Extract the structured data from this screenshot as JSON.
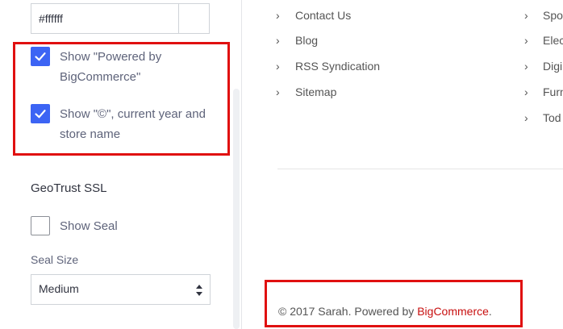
{
  "settings": {
    "color_value": "#ffffff",
    "powered_by_label_line1": "Show \"Powered by",
    "powered_by_label_line2": "BigCommerce\"",
    "copyright_label_line1": "Show \"©\", current year and",
    "copyright_label_line2": "store name",
    "geotrust_heading": "GeoTrust SSL",
    "show_seal_label": "Show Seal",
    "seal_size_label": "Seal Size",
    "seal_size_value": "Medium",
    "powered_by_checked": true,
    "copyright_checked": true,
    "show_seal_checked": false
  },
  "preview": {
    "links_col1": [
      "Contact Us",
      "Blog",
      "RSS Syndication",
      "Sitemap"
    ],
    "links_col2": [
      "Spo",
      "Elec",
      "Digi",
      "Furn",
      "Tod"
    ],
    "copyright_text": "© 2017 Sarah. Powered by ",
    "copyright_link": "BigCommerce",
    "copyright_end": "."
  },
  "colors": {
    "accent": "#3c64f4",
    "highlight": "#e01010",
    "link": "#c80f0f"
  }
}
